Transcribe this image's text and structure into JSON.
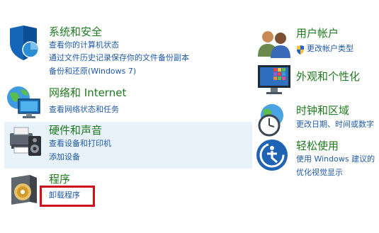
{
  "left": {
    "system_security": {
      "title": "系统和安全",
      "links": [
        "查看你的计算机状态",
        "通过文件历史记录保存你的文件备份副本",
        "备份和还原(Windows 7)"
      ]
    },
    "network": {
      "title": "网络和 Internet",
      "links": [
        "查看网络状态和任务"
      ]
    },
    "hardware": {
      "title": "硬件和声音",
      "links": [
        "查看设备和打印机",
        "添加设备"
      ]
    },
    "programs": {
      "title": "程序",
      "links": [
        "卸载程序"
      ]
    }
  },
  "right": {
    "accounts": {
      "title": "用户帐户",
      "links": [
        "更改帐户类型"
      ]
    },
    "appearance": {
      "title": "外观和个性化",
      "links": []
    },
    "clock": {
      "title": "时钟和区域",
      "links": [
        "更改日期、时间或数字"
      ]
    },
    "ease": {
      "title": "轻松使用",
      "links": [
        "使用 Windows 建议的",
        "优化视觉显示"
      ]
    }
  },
  "colors": {
    "title_green": "#1e7a1e",
    "link_blue": "#1f5aa8",
    "hover_bg": "#e8f2fb",
    "highlight_red": "#d0101a"
  }
}
